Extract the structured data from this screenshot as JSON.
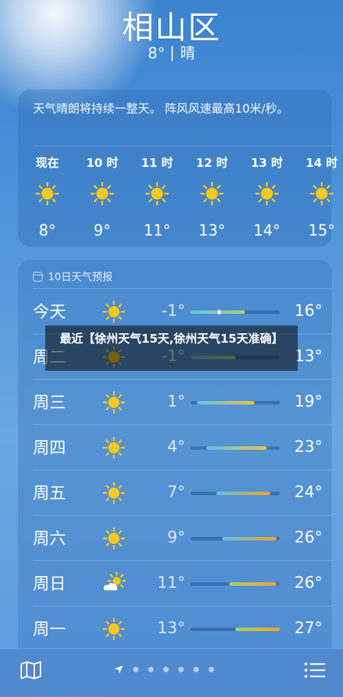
{
  "header": {
    "city": "相山区",
    "temp": "8°",
    "condition": "晴"
  },
  "hourly_card": {
    "summary": "天气晴朗将持续一整天。 阵风风速最高10米/秒。",
    "hours": [
      {
        "label": "现在",
        "icon": "sun-icon",
        "temp": "8°"
      },
      {
        "label": "10 时",
        "icon": "sun-icon",
        "temp": "9°"
      },
      {
        "label": "11 时",
        "icon": "sun-icon",
        "temp": "11°"
      },
      {
        "label": "12 时",
        "icon": "sun-icon",
        "temp": "13°"
      },
      {
        "label": "13 时",
        "icon": "sun-icon",
        "temp": "14°"
      },
      {
        "label": "14 时",
        "icon": "sun-icon",
        "temp": "15°"
      }
    ]
  },
  "daily_card": {
    "header": "10日天气预报",
    "range": {
      "min": -1,
      "max": 27
    },
    "days": [
      {
        "name": "今天",
        "icon": "sun-icon",
        "low": "-1°",
        "high": "16°",
        "low_val": -1,
        "high_val": 16,
        "current_val": 8
      },
      {
        "name": "周二",
        "icon": "sun-icon",
        "low": "-1°",
        "high": "13°",
        "low_val": -1,
        "high_val": 13
      },
      {
        "name": "周三",
        "icon": "sun-icon",
        "low": "1°",
        "high": "19°",
        "low_val": 1,
        "high_val": 19
      },
      {
        "name": "周四",
        "icon": "sun-icon",
        "low": "4°",
        "high": "23°",
        "low_val": 4,
        "high_val": 23
      },
      {
        "name": "周五",
        "icon": "sun-icon",
        "low": "7°",
        "high": "24°",
        "low_val": 7,
        "high_val": 24
      },
      {
        "name": "周六",
        "icon": "sun-icon",
        "low": "9°",
        "high": "26°",
        "low_val": 9,
        "high_val": 26
      },
      {
        "name": "周日",
        "icon": "partly-cloudy-icon",
        "low": "11°",
        "high": "26°",
        "low_val": 11,
        "high_val": 26
      },
      {
        "name": "周一",
        "icon": "sun-icon",
        "low": "13°",
        "high": "27°",
        "low_val": 13,
        "high_val": 27
      }
    ]
  },
  "banner": {
    "text": "最近【徐州天气15天,徐州天气15天准确】"
  },
  "bottom_bar": {
    "map_icon": "map-icon",
    "list_icon": "list-icon",
    "pager_count": 6,
    "location_icon": "location-arrow-icon"
  },
  "colors": {
    "sun": "#f7c81d",
    "bar_cold": "#5fc3ea",
    "bar_mild": "#a4d56a",
    "bar_warm": "#f2c33a",
    "bar_hot": "#f3a326"
  }
}
